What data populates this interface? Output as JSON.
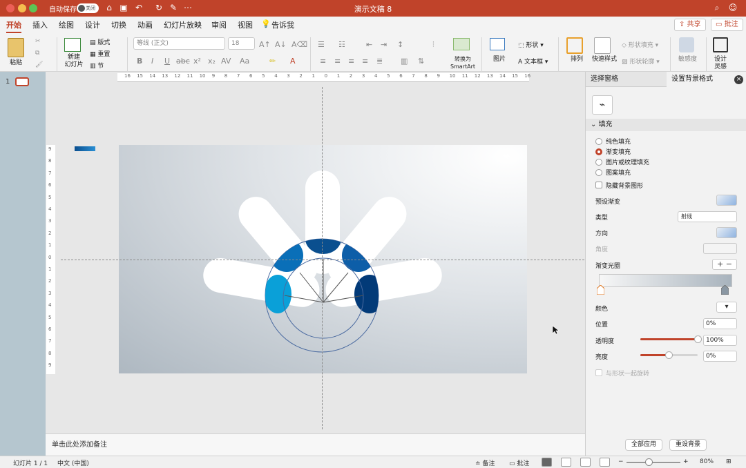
{
  "window": {
    "autosave_label": "自动保存",
    "autosave_toggle": "关闭",
    "title": "演示文稿 8"
  },
  "ribbon": {
    "tabs": [
      "开始",
      "插入",
      "绘图",
      "设计",
      "切换",
      "动画",
      "幻灯片放映",
      "审阅",
      "视图"
    ],
    "tell_me": "告诉我",
    "share_label": "共享",
    "comment_label": "批注",
    "paste_label": "粘贴",
    "new_slide_label": "新建\n幻灯片",
    "layout_label": "版式",
    "reset_label": "重置",
    "section_label": "节",
    "font_name": "等线 (正文)",
    "font_size": "18",
    "convert_smartart_label": "转换为\nSmartArt",
    "picture_label": "图片",
    "shape_label": "形状",
    "textbox_label": "文本框",
    "arrange_label": "排列",
    "quick_styles_label": "快速样式",
    "shape_fill_label": "形状填充",
    "shape_outline_label": "形状轮廓",
    "sensitivity_label": "敏感度",
    "designer_label": "设计\n灵感",
    "format_glyphs": [
      "B",
      "I",
      "U",
      "abc",
      "x²",
      "x₂",
      "AV",
      "Aa"
    ]
  },
  "thumbnails": {
    "slide_number": "1"
  },
  "ruler": {
    "h_numbers": [
      "16",
      "15",
      "14",
      "13",
      "12",
      "11",
      "10",
      "9",
      "8",
      "7",
      "6",
      "5",
      "4",
      "3",
      "2",
      "1",
      "0",
      "1",
      "2",
      "3",
      "4",
      "5",
      "6",
      "7",
      "8",
      "9",
      "10",
      "11",
      "12",
      "13",
      "14",
      "15",
      "16"
    ],
    "v_numbers": [
      "9",
      "8",
      "7",
      "6",
      "5",
      "4",
      "3",
      "2",
      "1",
      "0",
      "1",
      "2",
      "3",
      "4",
      "5",
      "6",
      "7",
      "8",
      "9"
    ]
  },
  "notes": {
    "placeholder": "单击此处添加备注"
  },
  "pane": {
    "tab_selection": "选择窗格",
    "tab_background": "设置背景格式",
    "close_glyph": "×",
    "fill_section": "填充",
    "fill_options": [
      "纯色填充",
      "渐变填充",
      "图片或纹理填充",
      "图案填充"
    ],
    "selected_fill": "渐变填充",
    "hide_bg_graphics": "隐藏背景图形",
    "preset_gradient": "预设渐变",
    "type_label": "类型",
    "type_value": "射线",
    "direction_label": "方向",
    "angle_label": "角度",
    "gradient_stops": "渐变光圈",
    "color_label": "颜色",
    "position_label": "位置",
    "position_value": "0%",
    "transparency_label": "透明度",
    "transparency_value": "100%",
    "transparency_level": 1.0,
    "brightness_label": "亮度",
    "brightness_value": "0%",
    "brightness_level": 0.5,
    "rotate_with_shape": "与形状一起旋转",
    "apply_all": "全部应用",
    "reset_bg": "重设背景"
  },
  "status": {
    "slide_count": "幻灯片 1 / 1",
    "language": "中文 (中国)",
    "notes_btn": "备注",
    "comments_btn": "批注",
    "zoom": "80%"
  },
  "colors": {
    "accent": "#c0432a",
    "petal_dark_navy": "#023a78",
    "petal_blue": "#0a4f8f",
    "petal_mid": "#0d5ea8",
    "petal_light": "#0aa0d8"
  }
}
